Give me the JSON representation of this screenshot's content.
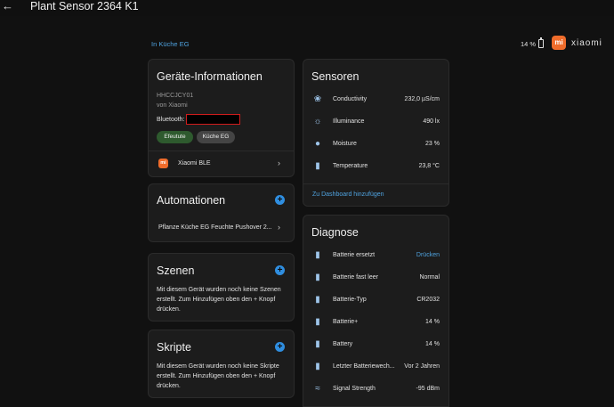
{
  "header": {
    "title": "Plant Sensor 2364 K1",
    "back_icon": "arrow-left-icon"
  },
  "area": {
    "label": "In Küche EG"
  },
  "top_battery": {
    "value": "14 %"
  },
  "brand": {
    "logo_text": "mi",
    "name": "xiaomi",
    "color": "#ef6c2b"
  },
  "device_info": {
    "title": "Geräte-Informationen",
    "model": "HHCCJCY01",
    "manufacturer": "von Xiaomi",
    "bluetooth_label": "Bluetooth:",
    "chips": [
      "Efeutute",
      "Küche EG"
    ],
    "integration": {
      "icon_text": "mi",
      "label": "Xiaomi BLE"
    }
  },
  "automations": {
    "title": "Automationen",
    "items": [
      {
        "label": "Pflanze Küche EG Feuchte Pushover 2..."
      }
    ]
  },
  "scenes": {
    "title": "Szenen",
    "text": "Mit diesem Gerät wurden noch keine Szenen erstellt. Zum Hinzufügen oben den + Knopf drücken."
  },
  "scripts": {
    "title": "Skripte",
    "text": "Mit diesem Gerät wurden noch keine Skripte erstellt. Zum Hinzufügen oben den + Knopf drücken."
  },
  "sensors": {
    "title": "Sensoren",
    "rows": [
      {
        "icon": "sprout-icon",
        "label": "Conductivity",
        "value": "232,0 µS/cm"
      },
      {
        "icon": "brightness-icon",
        "label": "Illuminance",
        "value": "490 lx"
      },
      {
        "icon": "water-drop-icon",
        "label": "Moisture",
        "value": "23 %"
      },
      {
        "icon": "thermometer-icon",
        "label": "Temperature",
        "value": "23,8 °C"
      }
    ],
    "dashboard_link": "Zu Dashboard hinzufügen"
  },
  "diagnose": {
    "title": "Diagnose",
    "rows": [
      {
        "icon": "battery-sync-icon",
        "label": "Batterie ersetzt",
        "value": "Drücken",
        "is_action": true
      },
      {
        "icon": "battery-alert-icon",
        "label": "Batterie fast leer",
        "value": "Normal"
      },
      {
        "icon": "battery-type-icon",
        "label": "Batterie-Typ",
        "value": "CR2032"
      },
      {
        "icon": "battery-icon",
        "label": "Batterie+",
        "value": "14 %"
      },
      {
        "icon": "battery-icon",
        "label": "Battery",
        "value": "14 %"
      },
      {
        "icon": "battery-clock-icon",
        "label": "Letzter Batteriewech...",
        "value": "Vor 2 Jahren"
      },
      {
        "icon": "wifi-icon",
        "label": "Signal Strength",
        "value": "-95 dBm"
      }
    ]
  }
}
